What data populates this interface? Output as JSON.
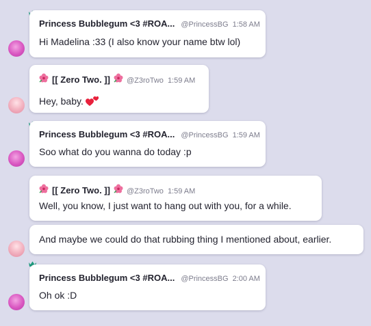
{
  "accent_color": "#1f9a7d",
  "messages": [
    {
      "id": "m1",
      "user": "Princess Bubblegum <3 #ROA...",
      "handle": "@PrincessBG",
      "time": "1:58 AM",
      "text": "Hi Madelina :33 (I also know your name btw lol)",
      "avatar_icon": "princess-bubblegum-avatar",
      "badge_icon": "crown-icon"
    },
    {
      "id": "m2",
      "user": "[[ Zero Two. ]]",
      "handle": "@Z3roTwo",
      "time": "1:59 AM",
      "text": "Hey, baby.",
      "emoji_icon": "two-hearts-icon",
      "avatar_icon": "zero-two-avatar",
      "name_decoration_icon": "hibiscus-icon"
    },
    {
      "id": "m3",
      "user": "Princess Bubblegum <3 #ROA...",
      "handle": "@PrincessBG",
      "time": "1:59 AM",
      "text": "Soo what do you wanna do today :p",
      "avatar_icon": "princess-bubblegum-avatar",
      "badge_icon": "crown-icon"
    },
    {
      "id": "m4",
      "user": "[[ Zero Two. ]]",
      "handle": "@Z3roTwo",
      "time": "1:59 AM",
      "text": "Well, you know, I just want to hang out with you, for a while.",
      "avatar_icon": "zero-two-avatar",
      "name_decoration_icon": "hibiscus-icon"
    },
    {
      "id": "m5",
      "text": "And maybe we could do that rubbing thing I mentioned about, earlier."
    },
    {
      "id": "m6",
      "user": "Princess Bubblegum <3 #ROA...",
      "handle": "@PrincessBG",
      "time": "2:00 AM",
      "text": "Oh ok :D",
      "avatar_icon": "princess-bubblegum-avatar",
      "badge_icon": "crown-icon"
    }
  ]
}
